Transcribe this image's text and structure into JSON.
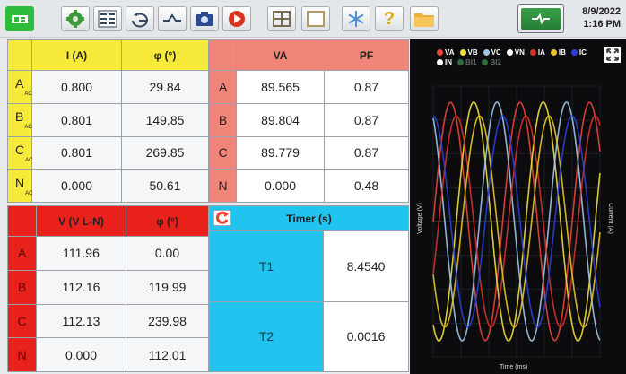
{
  "toolbar": {
    "icons": [
      "home-icon",
      "settings-gear-icon",
      "meter-icon",
      "phasor-icon",
      "waveform-icon",
      "camera-icon",
      "record-icon",
      "grid-icon",
      "window-icon",
      "snowflake-icon",
      "help-icon",
      "folder-icon"
    ],
    "datetime": {
      "date": "8/9/2022",
      "time": "1:16 PM"
    }
  },
  "current_table": {
    "headers": [
      "I (A)",
      "φ (°)"
    ],
    "rows": [
      {
        "label": "A",
        "sub": "AC",
        "current": "0.800",
        "phase": "29.84"
      },
      {
        "label": "B",
        "sub": "AC",
        "current": "0.801",
        "phase": "149.85"
      },
      {
        "label": "C",
        "sub": "AC",
        "current": "0.801",
        "phase": "269.85"
      },
      {
        "label": "N",
        "sub": "AC",
        "current": "0.000",
        "phase": "50.61"
      }
    ]
  },
  "power_table": {
    "headers": [
      "VA",
      "PF"
    ],
    "rows": [
      {
        "label": "A",
        "va": "89.565",
        "pf": "0.87"
      },
      {
        "label": "B",
        "va": "89.804",
        "pf": "0.87"
      },
      {
        "label": "C",
        "va": "89.779",
        "pf": "0.87"
      },
      {
        "label": "N",
        "va": "0.000",
        "pf": "0.48"
      }
    ]
  },
  "voltage_table": {
    "headers": [
      "V (V L-N)",
      "φ (°)"
    ],
    "rows": [
      {
        "label": "A",
        "voltage": "111.96",
        "phase": "0.00"
      },
      {
        "label": "B",
        "voltage": "112.16",
        "phase": "119.99"
      },
      {
        "label": "C",
        "voltage": "112.13",
        "phase": "239.98"
      },
      {
        "label": "N",
        "voltage": "0.000",
        "phase": "112.01"
      }
    ]
  },
  "timer_table": {
    "header": "Timer (s)",
    "rows": [
      {
        "label": "T1",
        "value": "8.4540"
      },
      {
        "label": "T2",
        "value": "0.0016"
      }
    ]
  },
  "scope": {
    "legend": [
      {
        "name": "VA",
        "color": "#e8453c",
        "active": true
      },
      {
        "name": "VB",
        "color": "#f0e03a",
        "active": true
      },
      {
        "name": "VC",
        "color": "#9ec6e8",
        "active": true
      },
      {
        "name": "VN",
        "color": "#ffffff",
        "active": true
      },
      {
        "name": "IA",
        "color": "#d6302a",
        "active": true
      },
      {
        "name": "IB",
        "color": "#e8c42a",
        "active": true
      },
      {
        "name": "IC",
        "color": "#2a3fd6",
        "active": true
      },
      {
        "name": "IN",
        "color": "#ffffff",
        "active": true
      },
      {
        "name": "BI1",
        "color": "#2f6b3c",
        "active": false
      },
      {
        "name": "BI2",
        "color": "#2f6b3c",
        "active": false
      }
    ],
    "ylabel_left": "Voltage (V)",
    "ylabel_right": "Current (A)",
    "xlabel": "Time (ms)"
  },
  "chart_data": {
    "type": "line",
    "xlabel": "Time (ms)",
    "ylabel": "Voltage (V)",
    "ylabel_right": "Current (A)",
    "xlim": [
      0,
      40
    ],
    "series": [
      {
        "name": "VA",
        "amplitude": 158.3,
        "phase_deg": 0,
        "freq_hz": 60
      },
      {
        "name": "VB",
        "amplitude": 158.6,
        "phase_deg": -120,
        "freq_hz": 60
      },
      {
        "name": "VC",
        "amplitude": 158.6,
        "phase_deg": -240,
        "freq_hz": 60
      },
      {
        "name": "IA",
        "amplitude": 1.13,
        "phase_deg": -29.84,
        "freq_hz": 60
      },
      {
        "name": "IB",
        "amplitude": 1.13,
        "phase_deg": -149.85,
        "freq_hz": 60
      },
      {
        "name": "IC",
        "amplitude": 1.13,
        "phase_deg": -269.85,
        "freq_hz": 60
      }
    ]
  }
}
